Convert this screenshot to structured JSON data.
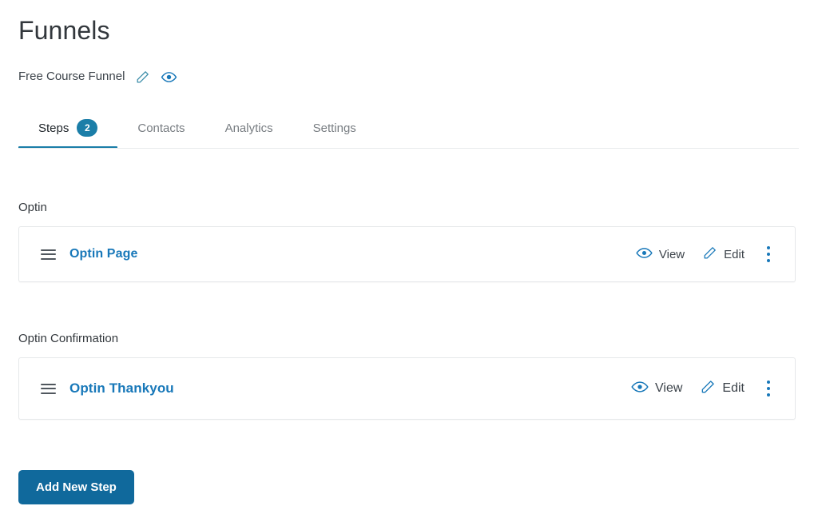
{
  "header": {
    "title": "Funnels",
    "funnel_name": "Free Course Funnel",
    "edit_icon": "pencil-icon",
    "preview_icon": "eye-icon"
  },
  "tabs": [
    {
      "label": "Steps",
      "badge": "2",
      "active": true
    },
    {
      "label": "Contacts",
      "badge": "",
      "active": false
    },
    {
      "label": "Analytics",
      "badge": "",
      "active": false
    },
    {
      "label": "Settings",
      "badge": "",
      "active": false
    }
  ],
  "sections": [
    {
      "heading": "Optin",
      "step": {
        "name": "Optin Page",
        "drag_icon": "drag-handle-icon",
        "view_label": "View",
        "view_icon": "eye-icon",
        "edit_label": "Edit",
        "edit_icon": "pencil-icon",
        "menu_icon": "kebab-menu-icon"
      }
    },
    {
      "heading": "Optin Confirmation",
      "step": {
        "name": "Optin Thankyou",
        "drag_icon": "drag-handle-icon",
        "view_label": "View",
        "view_icon": "eye-icon",
        "edit_label": "Edit",
        "edit_icon": "pencil-icon",
        "menu_icon": "kebab-menu-icon"
      }
    }
  ],
  "footer": {
    "add_step_label": "Add New Step"
  },
  "colors": {
    "accent_blue": "#1b7ea8",
    "link_blue": "#1878b9",
    "button_blue": "#10699c",
    "text_dark": "#32373c",
    "text_muted": "#787d82",
    "card_border": "#e6e8ea"
  }
}
